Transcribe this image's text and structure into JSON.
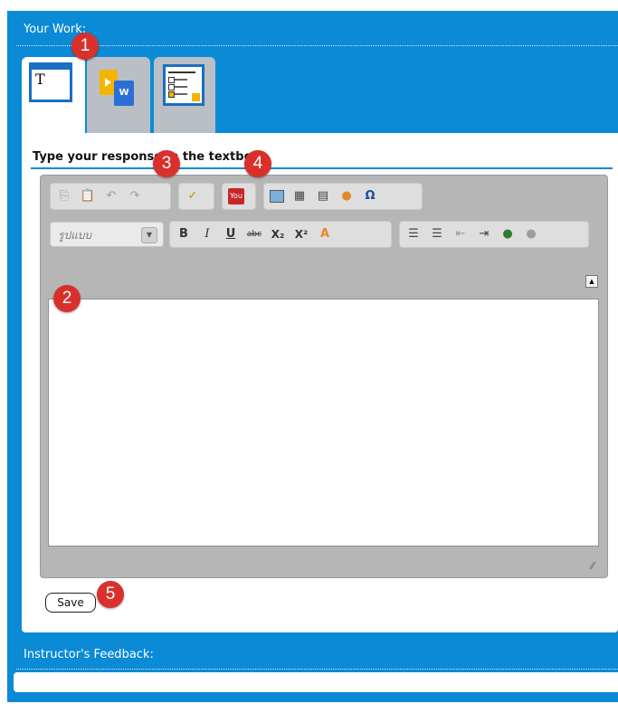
{
  "your_work": {
    "heading": "Your Work:"
  },
  "tabs": [
    {
      "name": "text-tab",
      "icon": "text-T-icon",
      "glyph": "T"
    },
    {
      "name": "file-upload-tab",
      "icon": "slides-word-files-icon"
    },
    {
      "name": "quiz-tab",
      "icon": "checklist-document-icon"
    }
  ],
  "prompt": {
    "label": "Type your response in the textbox"
  },
  "editor": {
    "format_placeholder": "รูปแบบ",
    "toolbar": [
      "copy-icon",
      "paste-icon",
      "undo-icon",
      "redo-icon",
      "spellcheck-icon",
      "youtube-icon",
      "image-icon",
      "table-icon",
      "horizontal-rule-icon",
      "smiley-icon",
      "special-char-omega-icon",
      "bold-icon",
      "italic-icon",
      "underline-icon",
      "strikethrough-icon",
      "subscript-icon",
      "superscript-icon",
      "text-color-icon",
      "numbered-list-icon",
      "bulleted-list-icon",
      "outdent-icon",
      "indent-icon",
      "link-icon",
      "unlink-icon"
    ],
    "bold_glyph": "B",
    "italic_glyph": "I",
    "underline_glyph": "U",
    "strike_glyph": "abc",
    "sub_glyph": "X₂",
    "sup_glyph": "X²",
    "color_glyph": "A",
    "omega_glyph": "Ω"
  },
  "save": {
    "label": "Save"
  },
  "feedback": {
    "heading": "Instructor's Feedback:"
  },
  "badges": [
    "1",
    "2",
    "3",
    "4",
    "5"
  ],
  "colors": {
    "panel": "#0b8ad6",
    "badge": "#d9302c"
  }
}
